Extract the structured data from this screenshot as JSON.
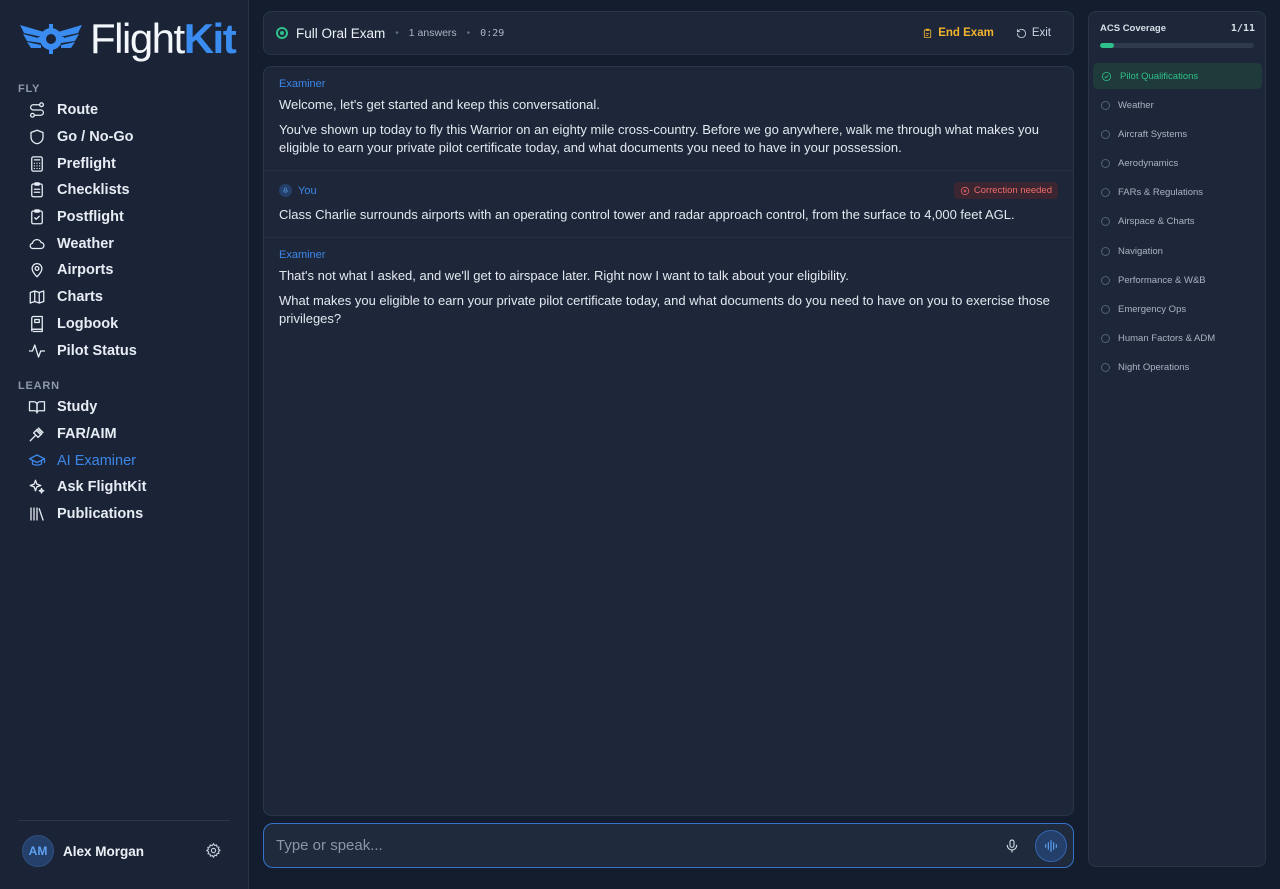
{
  "brand": {
    "name_part1": "Flight",
    "name_part2": "Kit"
  },
  "nav": {
    "fly_title": "FLY",
    "fly_items": [
      {
        "label": "Route",
        "icon": "route-icon"
      },
      {
        "label": "Go / No-Go",
        "icon": "shield-icon"
      },
      {
        "label": "Preflight",
        "icon": "calculator-icon"
      },
      {
        "label": "Checklists",
        "icon": "clipboard-icon"
      },
      {
        "label": "Postflight",
        "icon": "clipboard-check-icon"
      },
      {
        "label": "Weather",
        "icon": "cloud-icon"
      },
      {
        "label": "Airports",
        "icon": "map-pin-icon"
      },
      {
        "label": "Charts",
        "icon": "map-icon"
      },
      {
        "label": "Logbook",
        "icon": "book-icon"
      },
      {
        "label": "Pilot Status",
        "icon": "activity-icon"
      }
    ],
    "learn_title": "LEARN",
    "learn_items": [
      {
        "label": "Study",
        "icon": "open-book-icon"
      },
      {
        "label": "FAR/AIM",
        "icon": "gavel-icon"
      },
      {
        "label": "AI Examiner",
        "icon": "graduation-cap-icon",
        "active": true
      },
      {
        "label": "Ask FlightKit",
        "icon": "sparkles-icon"
      },
      {
        "label": "Publications",
        "icon": "library-icon"
      }
    ]
  },
  "user": {
    "initials": "AM",
    "name": "Alex Morgan"
  },
  "header": {
    "title": "Full Oral Exam",
    "answers": "1 answers",
    "timer": "0:29",
    "end_exam_label": "End Exam",
    "exit_label": "Exit"
  },
  "messages": [
    {
      "role": "Examiner",
      "paragraphs": [
        "Welcome, let's get started and keep this conversational.",
        "You've shown up today to fly this Warrior on an eighty mile cross-country. Before we go anywhere, walk me through what makes you eligible to earn your private pilot certificate today, and what documents you need to have in your possession."
      ]
    },
    {
      "role": "You",
      "badge": "Correction needed",
      "paragraphs": [
        "Class Charlie surrounds airports with an operating control tower and radar approach control, from the surface to 4,000 feet AGL."
      ]
    },
    {
      "role": "Examiner",
      "paragraphs": [
        "That's not what I asked, and we'll get to airspace later. Right now I want to talk about your eligibility.",
        "What makes you eligible to earn your private pilot certificate today, and what documents do you need to have on you to exercise those privileges?"
      ]
    }
  ],
  "composer": {
    "placeholder": "Type or speak..."
  },
  "coverage": {
    "title": "ACS Coverage",
    "count": "1/11",
    "progress": 0.09,
    "items": [
      {
        "label": "Pilot Qualifications",
        "done": true
      },
      {
        "label": "Weather",
        "done": false
      },
      {
        "label": "Aircraft Systems",
        "done": false
      },
      {
        "label": "Aerodynamics",
        "done": false
      },
      {
        "label": "FARs & Regulations",
        "done": false
      },
      {
        "label": "Airspace & Charts",
        "done": false
      },
      {
        "label": "Navigation",
        "done": false
      },
      {
        "label": "Performance & W&B",
        "done": false
      },
      {
        "label": "Emergency Ops",
        "done": false
      },
      {
        "label": "Human Factors & ADM",
        "done": false
      },
      {
        "label": "Night Operations",
        "done": false
      }
    ]
  },
  "colors": {
    "accent": "#3d87ea",
    "success": "#2fbf8a",
    "warning": "#f2b32e",
    "danger": "#f06b6b"
  }
}
